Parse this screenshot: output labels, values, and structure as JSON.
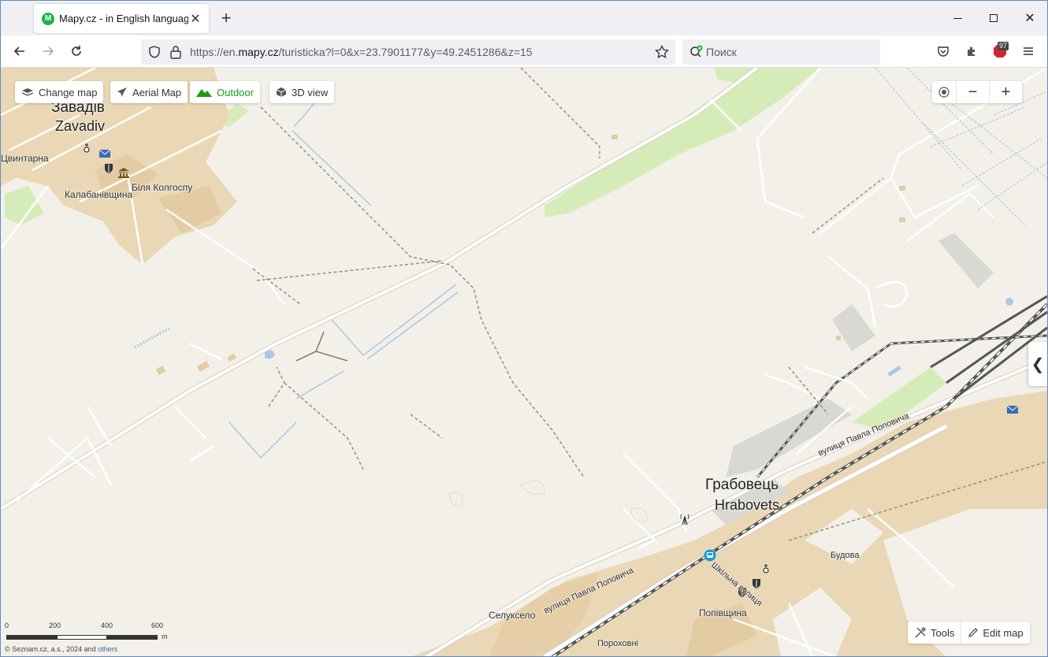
{
  "browser": {
    "tab_title": "Mapy.cz - in English language",
    "favicon_letter": "M",
    "url_prefix": "https://en.",
    "url_domain": "mapy.cz",
    "url_path": "/turisticka?l=0&x=23.7901177&y=49.2451286&z=15",
    "search_placeholder": "Поиск",
    "extension_badge": "97",
    "extension_label": "ABP"
  },
  "map_controls": {
    "change_map": "Change map",
    "aerial_map": "Aerial Map",
    "outdoor": "Outdoor",
    "view_3d": "3D view",
    "zoom_out": "−",
    "zoom_in": "+",
    "tools": "Tools",
    "edit_map": "Edit map",
    "side_toggle": "❮"
  },
  "labels": {
    "zavadiv_uk": "Завадів",
    "zavadiv_en": "Zavadiv",
    "tsvyntarna": "Цвинтарна",
    "bila_kolhospu": "Біля Колгоспу",
    "kalabanivshchyna": "Калабанівщина",
    "hrabovets_uk": "Грабовець",
    "hrabovets_en": "Hrabovets",
    "street_popovycha_1": "вулиця Павла Поповича",
    "street_popovycha_2": "вулиця Павла Поповича",
    "street_shkilna": "Шкільна вулиця",
    "budova": "Будова",
    "seluksele": "Селуксело",
    "popivshchyna": "Попівщина",
    "porokhovni": "Пороховні"
  },
  "scale": {
    "ticks": [
      "0",
      "200",
      "400",
      "600"
    ],
    "unit": "m"
  },
  "copyright": {
    "text": "© Seznam.cz, a.s., 2024 and ",
    "link": "others"
  },
  "colors": {
    "map_bg": "#f2f0e8",
    "urban": "#e8d6b6",
    "forest": "#d6ecb8",
    "water": "#a8c8e8",
    "road": "#ffffff",
    "outdoor_green": "#1a9a1a"
  }
}
